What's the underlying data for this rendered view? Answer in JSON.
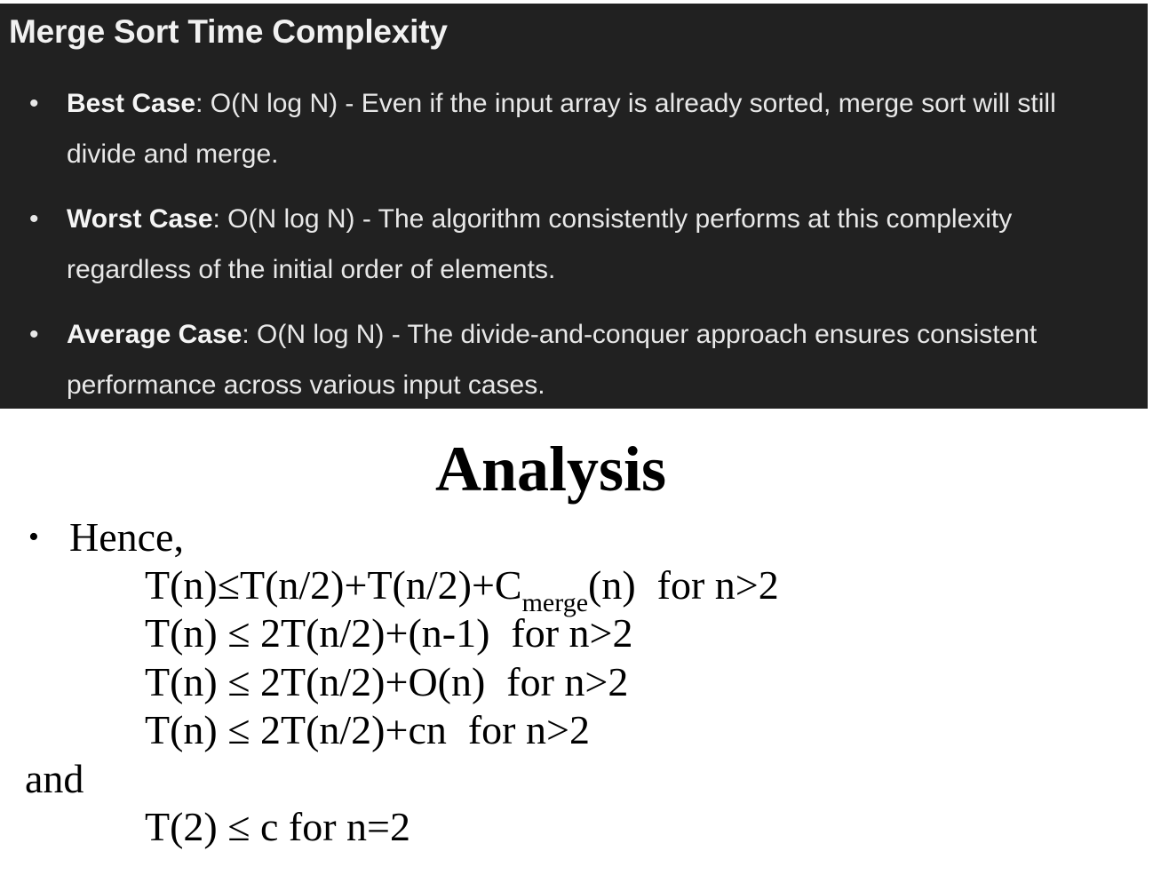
{
  "panel": {
    "title": "Merge Sort Time Complexity",
    "bullet": "•",
    "cases": [
      {
        "term": "Best Case",
        "text": ": O(N log N) - Even if the input array is already sorted, merge sort will still divide and merge."
      },
      {
        "term": "Worst Case",
        "text": ": O(N log N) - The algorithm consistently performs at this complexity regardless of the initial order of elements."
      },
      {
        "term": "Average Case",
        "text": ": O(N log N) - The divide-and-conquer approach ensures consistent performance across various input cases."
      }
    ],
    "colors": {
      "background": "#212121",
      "text": "#e8e8e8"
    }
  },
  "slide": {
    "title": "Analysis",
    "bullet": "•",
    "intro": "Hence,",
    "equation1": {
      "lhs": "T(n)≤T(n/2)+T(n/2)+C",
      "sub": "merge",
      "rest": "(n)",
      "cond": "for n>2"
    },
    "equation2": {
      "expr": "T(n) ≤ 2T(n/2)+(n-1)",
      "cond": "for n>2"
    },
    "equation3": {
      "expr": "T(n) ≤ 2T(n/2)+O(n)",
      "cond": "for n>2"
    },
    "equation4": {
      "expr": "T(n) ≤ 2T(n/2)+cn",
      "cond": "for n>2"
    },
    "and_label": "and",
    "base_case": {
      "expr": "T(2) ≤ c",
      "cond": "for n=2"
    }
  }
}
